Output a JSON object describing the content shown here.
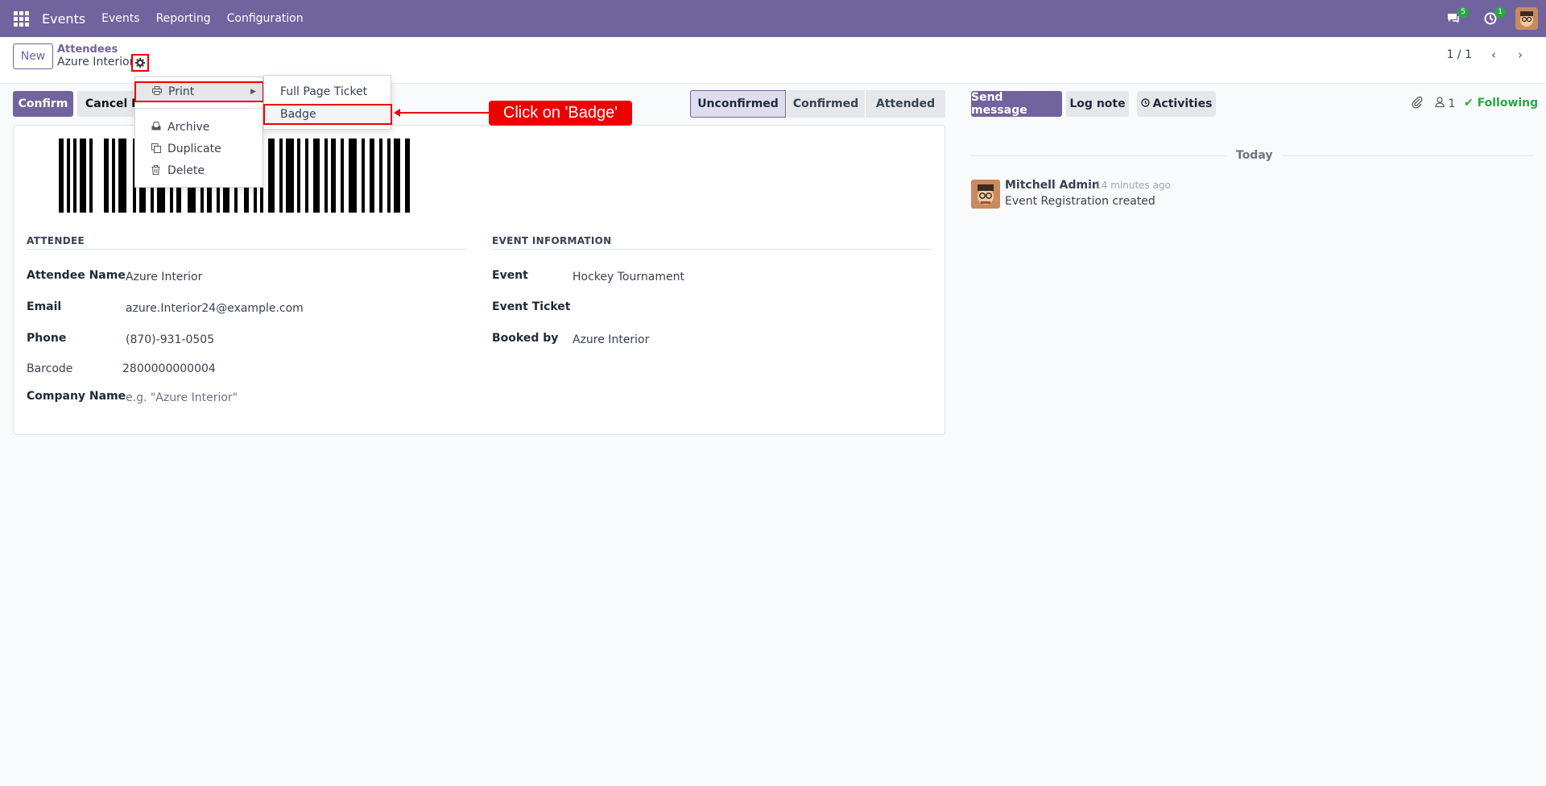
{
  "navbar": {
    "app_name": "Events",
    "menu": [
      "Events",
      "Reporting",
      "Configuration"
    ],
    "messages_count": "5",
    "activities_count": "1"
  },
  "control_panel": {
    "new_label": "New",
    "breadcrumb_parent": "Attendees",
    "breadcrumb_current": "Azure Interior",
    "pager": "1 / 1"
  },
  "actions": {
    "confirm_label": "Confirm",
    "cancel_label": "Cancel Registration"
  },
  "statusbar": {
    "stages": [
      "Unconfirmed",
      "Confirmed",
      "Attended"
    ],
    "active": "Unconfirmed"
  },
  "form": {
    "attendee_section": "ATTENDEE",
    "event_section": "EVENT INFORMATION",
    "fields": {
      "attendee_name_label": "Attendee Name",
      "attendee_name": "Azure Interior",
      "email_label": "Email",
      "email": "azure.Interior24@example.com",
      "phone_label": "Phone",
      "phone": "(870)-931-0505",
      "barcode_label": "Barcode",
      "barcode": "2800000000004",
      "company_label": "Company Name",
      "company_placeholder": "e.g. \"Azure Interior\"",
      "event_label": "Event",
      "event": "Hockey Tournament",
      "ticket_label": "Event Ticket",
      "booked_by_label": "Booked by",
      "booked_by": "Azure Interior"
    }
  },
  "gear_menu": {
    "print_label": "Print",
    "archive_label": "Archive",
    "duplicate_label": "Duplicate",
    "delete_label": "Delete"
  },
  "print_submenu": {
    "full_page_ticket": "Full Page Ticket",
    "badge": "Badge"
  },
  "chatter": {
    "send_message": "Send message",
    "log_note": "Log note",
    "activities": "Activities",
    "followers_count": "1",
    "following": "Following",
    "today": "Today",
    "message": {
      "author": "Mitchell Admin",
      "time": "- 14 minutes ago",
      "body": "Event Registration created"
    }
  },
  "annotation": {
    "text": "Click on 'Badge'",
    "color": "#ee0000"
  },
  "colors": {
    "brand": "#71639e",
    "success": "#28a745"
  }
}
